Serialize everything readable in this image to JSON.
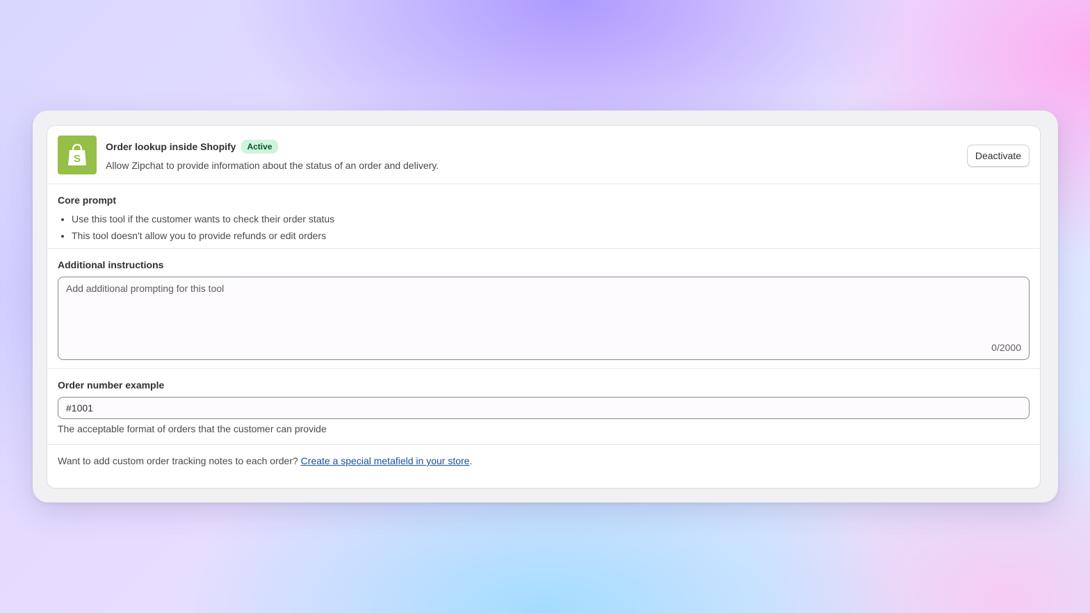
{
  "tool": {
    "title": "Order lookup inside Shopify",
    "status_badge": "Active",
    "description": "Allow Zipchat to provide information about the status of an order and delivery.",
    "deactivate_label": "Deactivate",
    "logo_icon": "shopify-bag-icon",
    "logo_color": "#95bf47"
  },
  "core_prompt": {
    "label": "Core prompt",
    "items": [
      "Use this tool if the customer wants to check their order status",
      "This tool doesn't allow you to provide refunds or edit orders"
    ]
  },
  "additional_instructions": {
    "label": "Additional instructions",
    "placeholder": "Add additional prompting for this tool",
    "value": "",
    "counter": "0/2000"
  },
  "order_number": {
    "label": "Order number example",
    "value": "#1001",
    "help": "The acceptable format of orders that the customer can provide"
  },
  "footer": {
    "text": "Want to add custom order tracking notes to each order?",
    "link_label": "Create a special metafield in your store",
    "suffix": "."
  }
}
